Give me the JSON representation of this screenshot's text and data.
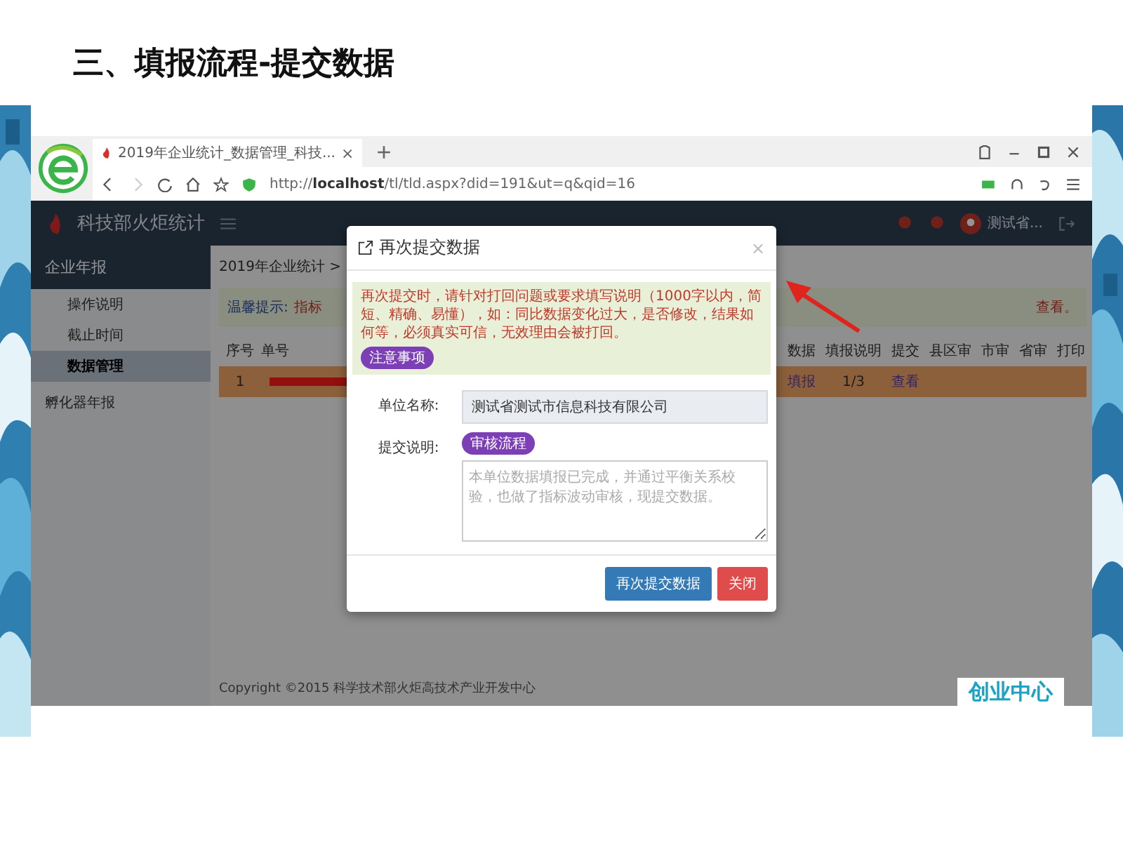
{
  "slide_title": "三、填报流程-提交数据",
  "browser": {
    "tab_title": "2019年企业统计_数据管理_科技...",
    "tab_close": "×",
    "url_scheme": "http://",
    "url_host": "localhost",
    "url_path": "/tl/tld.aspx?did=191&ut=q&qid=16"
  },
  "app": {
    "brand": "科技部火炬统计",
    "user": "测试省...",
    "breadcrumb": "2019年企业统计 >",
    "tip_label": "温馨提示:",
    "tip_text": "指标",
    "tip_tail": "查看。"
  },
  "sidebar": {
    "section": "企业年报",
    "items": [
      {
        "label": "操作说明",
        "selected": false
      },
      {
        "label": "截止时间",
        "selected": false
      },
      {
        "label": "数据管理",
        "selected": true
      }
    ],
    "other_section": "孵化器年报"
  },
  "table": {
    "left_columns": [
      "序号",
      "单号"
    ],
    "right_columns": [
      "数据",
      "填报说明",
      "提交",
      "县区审",
      "市审",
      "省审",
      "打印"
    ],
    "rows": [
      {
        "index": "1",
        "redacted": true,
        "selected": true,
        "cells": [
          "填报",
          "1/3",
          "查看"
        ]
      }
    ]
  },
  "copyright": "Copyright ©2015 科学技术部火炬高技术产业开发中心",
  "dialog": {
    "title": "再次提交数据",
    "close": "×",
    "notice": "再次提交时，请针对打回问题或要求填写说明（1000字以内，简短、精确、易懂），如：同比数据变化过大，是否修改，结果如何等，必须真实可信，无效理由会被打回。",
    "notice_badge": "注意事项",
    "fields": [
      {
        "kind": "readonly",
        "label": "单位名称:",
        "value": "测试省测试市信息科技有限公司"
      },
      {
        "kind": "textarea",
        "label": "提交说明:",
        "badge": "审核流程",
        "placeholder": "本单位数据填报已完成，并通过平衡关系校验，也做了指标波动审核，现提交数据。"
      }
    ],
    "buttons": [
      {
        "kind": "primary",
        "label": "再次提交数据"
      },
      {
        "kind": "danger",
        "label": "关闭"
      }
    ]
  },
  "logo": "创业中心"
}
